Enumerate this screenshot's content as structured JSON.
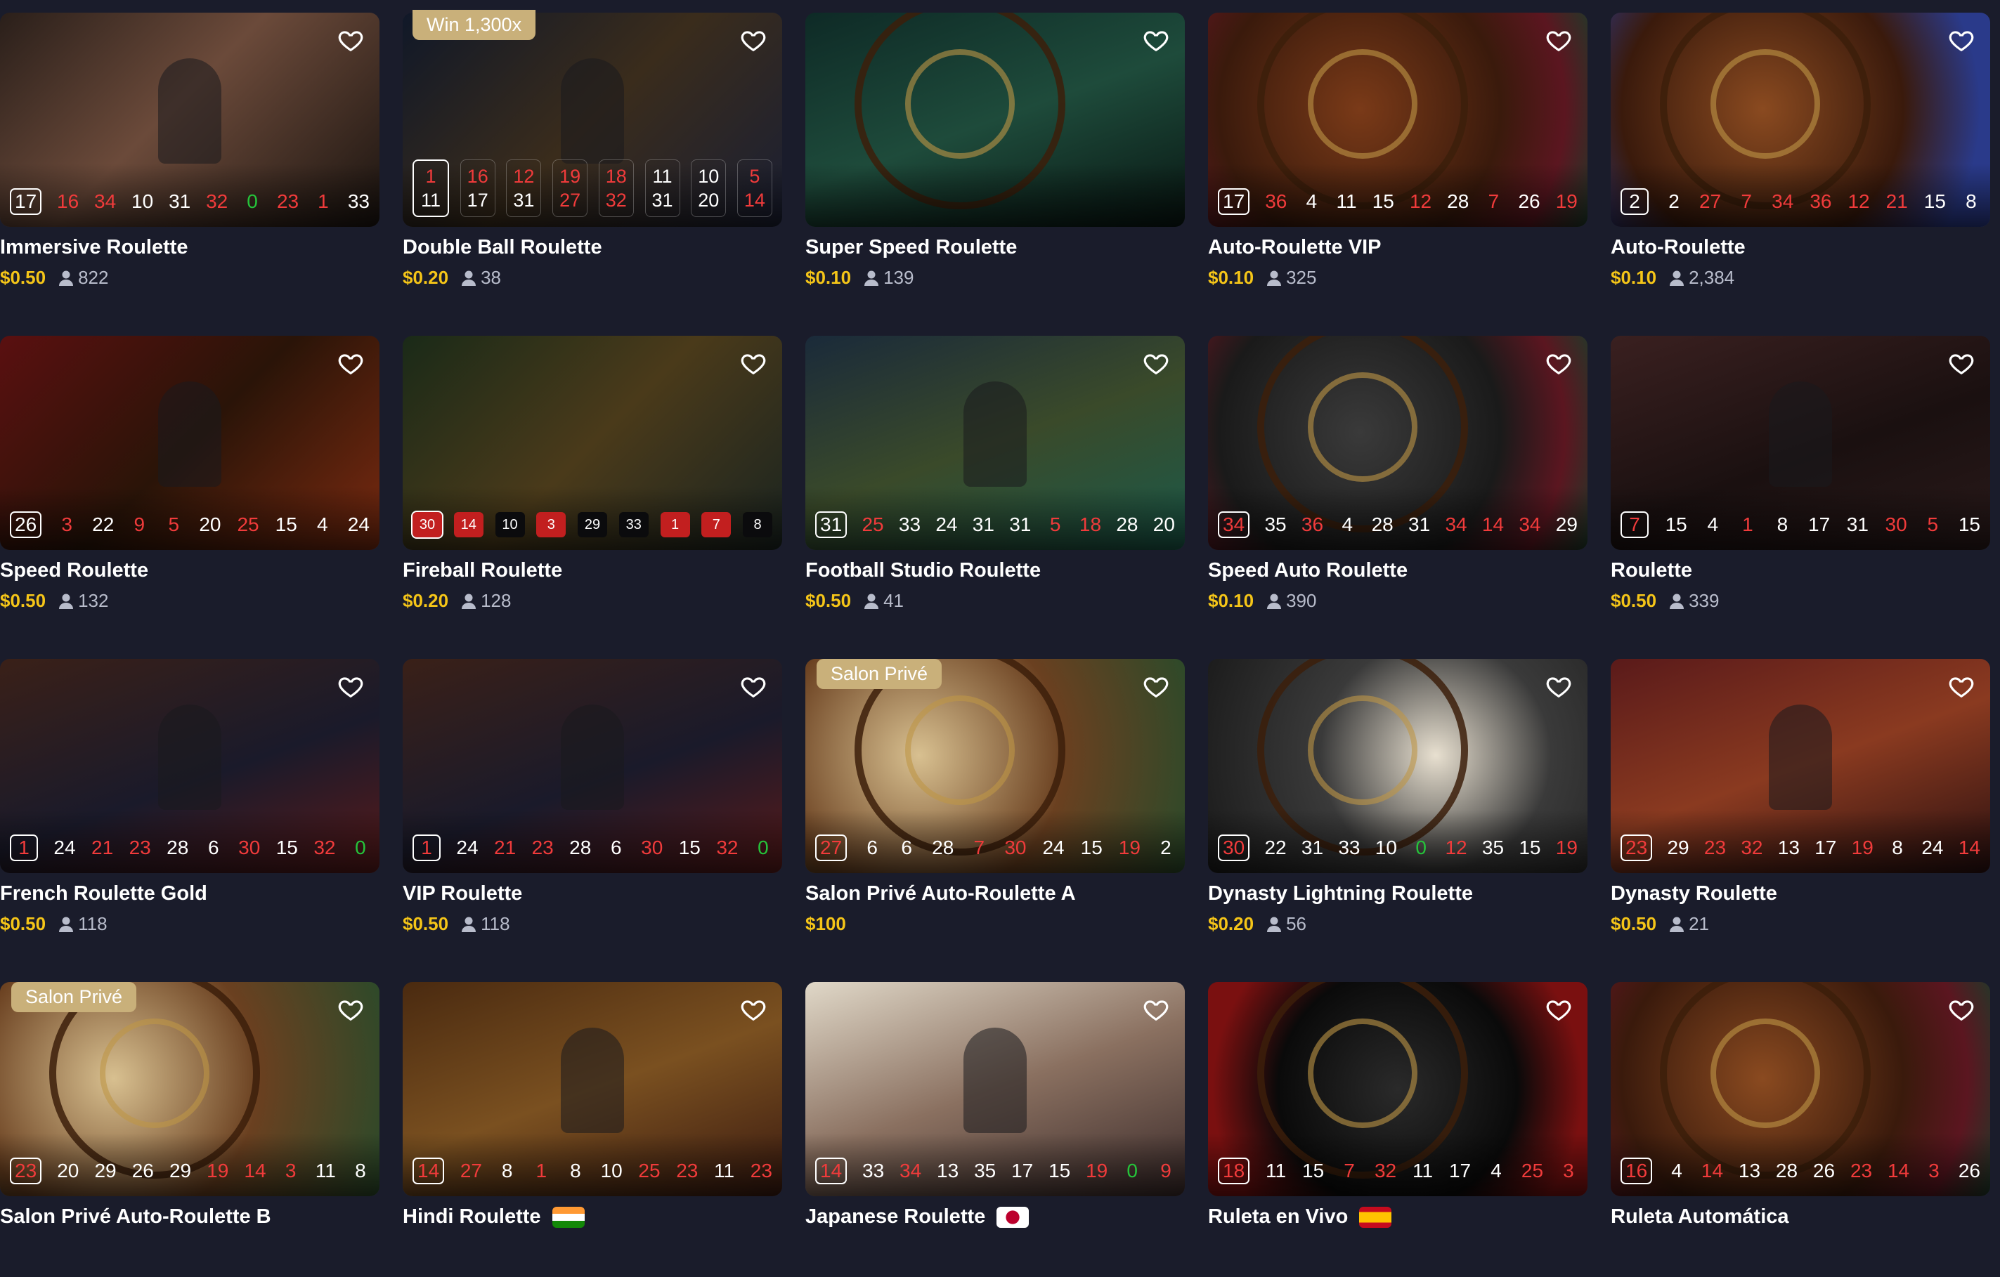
{
  "colors": {
    "background": "#1a1c2b",
    "price": "#f5c518",
    "players": "#b8bccb",
    "red_number": "#f03b3b",
    "green_number": "#25c43a",
    "badge": "#c9b07a"
  },
  "icons": {
    "favorite": "heart-outline-icon",
    "players": "user-icon"
  },
  "games": [
    {
      "title": "Immersive Roulette",
      "price": "$0.50",
      "players": "822",
      "badge": "",
      "results": [
        [
          "17",
          "black"
        ],
        [
          "16",
          "red"
        ],
        [
          "34",
          "red"
        ],
        [
          "10",
          "black"
        ],
        [
          "31",
          "black"
        ],
        [
          "32",
          "red"
        ],
        [
          "0",
          "green"
        ],
        [
          "23",
          "red"
        ],
        [
          "1",
          "red"
        ],
        [
          "33",
          "black"
        ]
      ]
    },
    {
      "title": "Double Ball Roulette",
      "price": "$0.20",
      "players": "38",
      "badge": "Win 1,300x",
      "layout": "double",
      "results": [
        [
          "1",
          "red",
          "11",
          "black"
        ],
        [
          "16",
          "red",
          "17",
          "black"
        ],
        [
          "12",
          "red",
          "31",
          "black"
        ],
        [
          "19",
          "red",
          "27",
          "red"
        ],
        [
          "18",
          "red",
          "32",
          "red"
        ],
        [
          "11",
          "black",
          "31",
          "black"
        ],
        [
          "10",
          "black",
          "20",
          "black"
        ],
        [
          "5",
          "red",
          "14",
          "red"
        ]
      ]
    },
    {
      "title": "Super Speed Roulette",
      "price": "$0.10",
      "players": "139",
      "badge": "",
      "results": []
    },
    {
      "title": "Auto-Roulette VIP",
      "price": "$0.10",
      "players": "325",
      "badge": "",
      "results": [
        [
          "17",
          "black"
        ],
        [
          "36",
          "red"
        ],
        [
          "4",
          "black"
        ],
        [
          "11",
          "black"
        ],
        [
          "15",
          "black"
        ],
        [
          "12",
          "red"
        ],
        [
          "28",
          "black"
        ],
        [
          "7",
          "red"
        ],
        [
          "26",
          "black"
        ],
        [
          "19",
          "red"
        ]
      ]
    },
    {
      "title": "Auto-Roulette",
      "price": "$0.10",
      "players": "2,384",
      "badge": "",
      "results": [
        [
          "2",
          "black"
        ],
        [
          "2",
          "black"
        ],
        [
          "27",
          "red"
        ],
        [
          "7",
          "red"
        ],
        [
          "34",
          "red"
        ],
        [
          "36",
          "red"
        ],
        [
          "12",
          "red"
        ],
        [
          "21",
          "red"
        ],
        [
          "15",
          "black"
        ],
        [
          "8",
          "black"
        ]
      ]
    },
    {
      "title": "Speed Roulette",
      "price": "$0.50",
      "players": "132",
      "badge": "",
      "results": [
        [
          "26",
          "black"
        ],
        [
          "3",
          "red"
        ],
        [
          "22",
          "black"
        ],
        [
          "9",
          "red"
        ],
        [
          "5",
          "red"
        ],
        [
          "20",
          "black"
        ],
        [
          "25",
          "red"
        ],
        [
          "15",
          "black"
        ],
        [
          "4",
          "black"
        ],
        [
          "24",
          "black"
        ]
      ]
    },
    {
      "title": "Fireball Roulette",
      "price": "$0.20",
      "players": "128",
      "badge": "",
      "layout": "chips",
      "results": [
        [
          "30",
          "red"
        ],
        [
          "14",
          "red"
        ],
        [
          "10",
          "black"
        ],
        [
          "3",
          "red"
        ],
        [
          "29",
          "black"
        ],
        [
          "33",
          "black"
        ],
        [
          "1",
          "red"
        ],
        [
          "7",
          "red"
        ],
        [
          "8",
          "black"
        ]
      ]
    },
    {
      "title": "Football Studio Roulette",
      "price": "$0.50",
      "players": "41",
      "badge": "",
      "results": [
        [
          "31",
          "black"
        ],
        [
          "25",
          "red"
        ],
        [
          "33",
          "black"
        ],
        [
          "24",
          "black"
        ],
        [
          "31",
          "black"
        ],
        [
          "31",
          "black"
        ],
        [
          "5",
          "red"
        ],
        [
          "18",
          "red"
        ],
        [
          "28",
          "black"
        ],
        [
          "20",
          "black"
        ]
      ]
    },
    {
      "title": "Speed Auto Roulette",
      "price": "$0.10",
      "players": "390",
      "badge": "",
      "results": [
        [
          "34",
          "red"
        ],
        [
          "35",
          "black"
        ],
        [
          "36",
          "red"
        ],
        [
          "4",
          "black"
        ],
        [
          "28",
          "black"
        ],
        [
          "31",
          "black"
        ],
        [
          "34",
          "red"
        ],
        [
          "14",
          "red"
        ],
        [
          "34",
          "red"
        ],
        [
          "29",
          "black"
        ]
      ]
    },
    {
      "title": "Roulette",
      "price": "$0.50",
      "players": "339",
      "badge": "",
      "results": [
        [
          "7",
          "red"
        ],
        [
          "15",
          "black"
        ],
        [
          "4",
          "black"
        ],
        [
          "1",
          "red"
        ],
        [
          "8",
          "black"
        ],
        [
          "17",
          "black"
        ],
        [
          "31",
          "black"
        ],
        [
          "30",
          "red"
        ],
        [
          "5",
          "red"
        ],
        [
          "15",
          "black"
        ]
      ]
    },
    {
      "title": "French Roulette Gold",
      "price": "$0.50",
      "players": "118",
      "badge": "",
      "results": [
        [
          "1",
          "red"
        ],
        [
          "24",
          "black"
        ],
        [
          "21",
          "red"
        ],
        [
          "23",
          "red"
        ],
        [
          "28",
          "black"
        ],
        [
          "6",
          "black"
        ],
        [
          "30",
          "red"
        ],
        [
          "15",
          "black"
        ],
        [
          "32",
          "red"
        ],
        [
          "0",
          "green"
        ]
      ]
    },
    {
      "title": "VIP Roulette",
      "price": "$0.50",
      "players": "118",
      "badge": "",
      "results": [
        [
          "1",
          "red"
        ],
        [
          "24",
          "black"
        ],
        [
          "21",
          "red"
        ],
        [
          "23",
          "red"
        ],
        [
          "28",
          "black"
        ],
        [
          "6",
          "black"
        ],
        [
          "30",
          "red"
        ],
        [
          "15",
          "black"
        ],
        [
          "32",
          "red"
        ],
        [
          "0",
          "green"
        ]
      ]
    },
    {
      "title": "Salon Privé Auto-Roulette A",
      "price": "$100",
      "players": "",
      "badge": "Salon Privé",
      "results": [
        [
          "27",
          "red"
        ],
        [
          "6",
          "black"
        ],
        [
          "6",
          "black"
        ],
        [
          "28",
          "black"
        ],
        [
          "7",
          "red"
        ],
        [
          "30",
          "red"
        ],
        [
          "24",
          "black"
        ],
        [
          "15",
          "black"
        ],
        [
          "19",
          "red"
        ],
        [
          "2",
          "black"
        ]
      ]
    },
    {
      "title": "Dynasty Lightning Roulette",
      "price": "$0.20",
      "players": "56",
      "badge": "",
      "results": [
        [
          "30",
          "red"
        ],
        [
          "22",
          "black"
        ],
        [
          "31",
          "black"
        ],
        [
          "33",
          "black"
        ],
        [
          "10",
          "black"
        ],
        [
          "0",
          "green"
        ],
        [
          "12",
          "red"
        ],
        [
          "35",
          "black"
        ],
        [
          "15",
          "black"
        ],
        [
          "19",
          "red"
        ]
      ]
    },
    {
      "title": "Dynasty Roulette",
      "price": "$0.50",
      "players": "21",
      "badge": "",
      "results": [
        [
          "23",
          "red"
        ],
        [
          "29",
          "black"
        ],
        [
          "23",
          "red"
        ],
        [
          "32",
          "red"
        ],
        [
          "13",
          "black"
        ],
        [
          "17",
          "black"
        ],
        [
          "19",
          "red"
        ],
        [
          "8",
          "black"
        ],
        [
          "24",
          "black"
        ],
        [
          "14",
          "red"
        ]
      ]
    },
    {
      "title": "Salon Privé Auto-Roulette B",
      "price": "",
      "players": "",
      "badge": "Salon Privé",
      "results": [
        [
          "23",
          "red"
        ],
        [
          "20",
          "black"
        ],
        [
          "29",
          "black"
        ],
        [
          "26",
          "black"
        ],
        [
          "29",
          "black"
        ],
        [
          "19",
          "red"
        ],
        [
          "14",
          "red"
        ],
        [
          "3",
          "red"
        ],
        [
          "11",
          "black"
        ],
        [
          "8",
          "black"
        ]
      ]
    },
    {
      "title": "Hindi Roulette",
      "price": "",
      "players": "",
      "badge": "",
      "flag": "india-flag-icon",
      "results": [
        [
          "14",
          "red"
        ],
        [
          "27",
          "red"
        ],
        [
          "8",
          "black"
        ],
        [
          "1",
          "red"
        ],
        [
          "8",
          "black"
        ],
        [
          "10",
          "black"
        ],
        [
          "25",
          "red"
        ],
        [
          "23",
          "red"
        ],
        [
          "11",
          "black"
        ],
        [
          "23",
          "red"
        ]
      ]
    },
    {
      "title": "Japanese Roulette",
      "price": "",
      "players": "",
      "badge": "",
      "flag": "japan-flag-icon",
      "results": [
        [
          "14",
          "red"
        ],
        [
          "33",
          "black"
        ],
        [
          "34",
          "red"
        ],
        [
          "13",
          "black"
        ],
        [
          "35",
          "black"
        ],
        [
          "17",
          "black"
        ],
        [
          "15",
          "black"
        ],
        [
          "19",
          "red"
        ],
        [
          "0",
          "green"
        ],
        [
          "9",
          "red"
        ]
      ]
    },
    {
      "title": "Ruleta en Vivo",
      "price": "",
      "players": "",
      "badge": "",
      "flag": "spain-flag-icon",
      "results": [
        [
          "18",
          "red"
        ],
        [
          "11",
          "black"
        ],
        [
          "15",
          "black"
        ],
        [
          "7",
          "red"
        ],
        [
          "32",
          "red"
        ],
        [
          "11",
          "black"
        ],
        [
          "17",
          "black"
        ],
        [
          "4",
          "black"
        ],
        [
          "25",
          "red"
        ],
        [
          "3",
          "red"
        ]
      ]
    },
    {
      "title": "Ruleta Automática",
      "price": "",
      "players": "",
      "badge": "",
      "results": [
        [
          "16",
          "red"
        ],
        [
          "4",
          "black"
        ],
        [
          "14",
          "red"
        ],
        [
          "13",
          "black"
        ],
        [
          "28",
          "black"
        ],
        [
          "26",
          "black"
        ],
        [
          "23",
          "red"
        ],
        [
          "14",
          "red"
        ],
        [
          "3",
          "red"
        ],
        [
          "26",
          "black"
        ]
      ]
    }
  ]
}
